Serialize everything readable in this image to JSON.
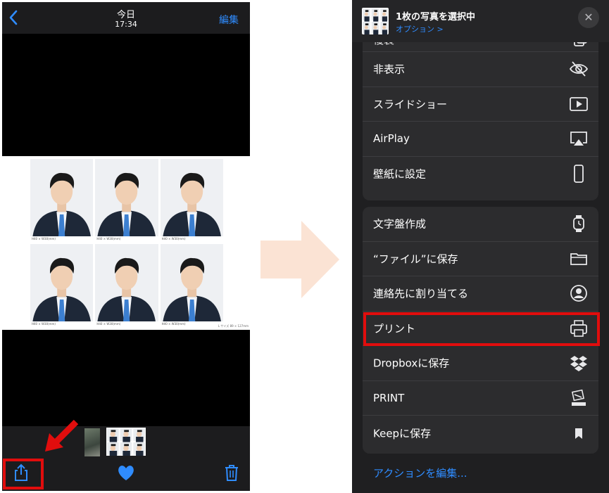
{
  "left_phone": {
    "header": {
      "back_icon": "chevron-left-icon",
      "title": "今日",
      "time": "17:34",
      "edit_label": "編集"
    },
    "photo_sheet": {
      "captions": [
        "H40 × W30(mm)",
        "H40 × W30(mm)",
        "H40 × W30(mm)",
        "H40 × W30(mm)",
        "H40 × W30(mm)",
        "H40 × W30(mm)"
      ],
      "note": "L サイズ 89 × 127mm"
    },
    "toolbar": {
      "share_icon": "share-icon",
      "favorite_icon": "heart-icon",
      "delete_icon": "trash-icon"
    }
  },
  "right_phone": {
    "header": {
      "title": "1枚の写真を選択中",
      "options_label": "オプション >",
      "close_icon": "close-icon"
    },
    "group1": [
      {
        "label": "複製",
        "icon": "duplicate-icon"
      },
      {
        "label": "非表示",
        "icon": "eye-slash-icon"
      },
      {
        "label": "スライドショー",
        "icon": "play-icon"
      },
      {
        "label": "AirPlay",
        "icon": "airplay-icon"
      },
      {
        "label": "壁紙に設定",
        "icon": "phone-icon"
      }
    ],
    "group2": [
      {
        "label": "文字盤作成",
        "icon": "watch-icon"
      },
      {
        "label": "“ファイル”に保存",
        "icon": "folder-icon"
      },
      {
        "label": "連絡先に割り当てる",
        "icon": "contact-icon"
      },
      {
        "label": "プリント",
        "icon": "printer-icon"
      },
      {
        "label": "Dropboxに保存",
        "icon": "dropbox-icon"
      },
      {
        "label": "PRINT",
        "icon": "canon-icon"
      },
      {
        "label": "Keepに保存",
        "icon": "bookmark-icon"
      }
    ],
    "edit_actions_label": "アクションを編集..."
  },
  "colors": {
    "accent": "#2f8cff",
    "highlight": "#e10d0d",
    "arrow": "#fbe3d4"
  }
}
